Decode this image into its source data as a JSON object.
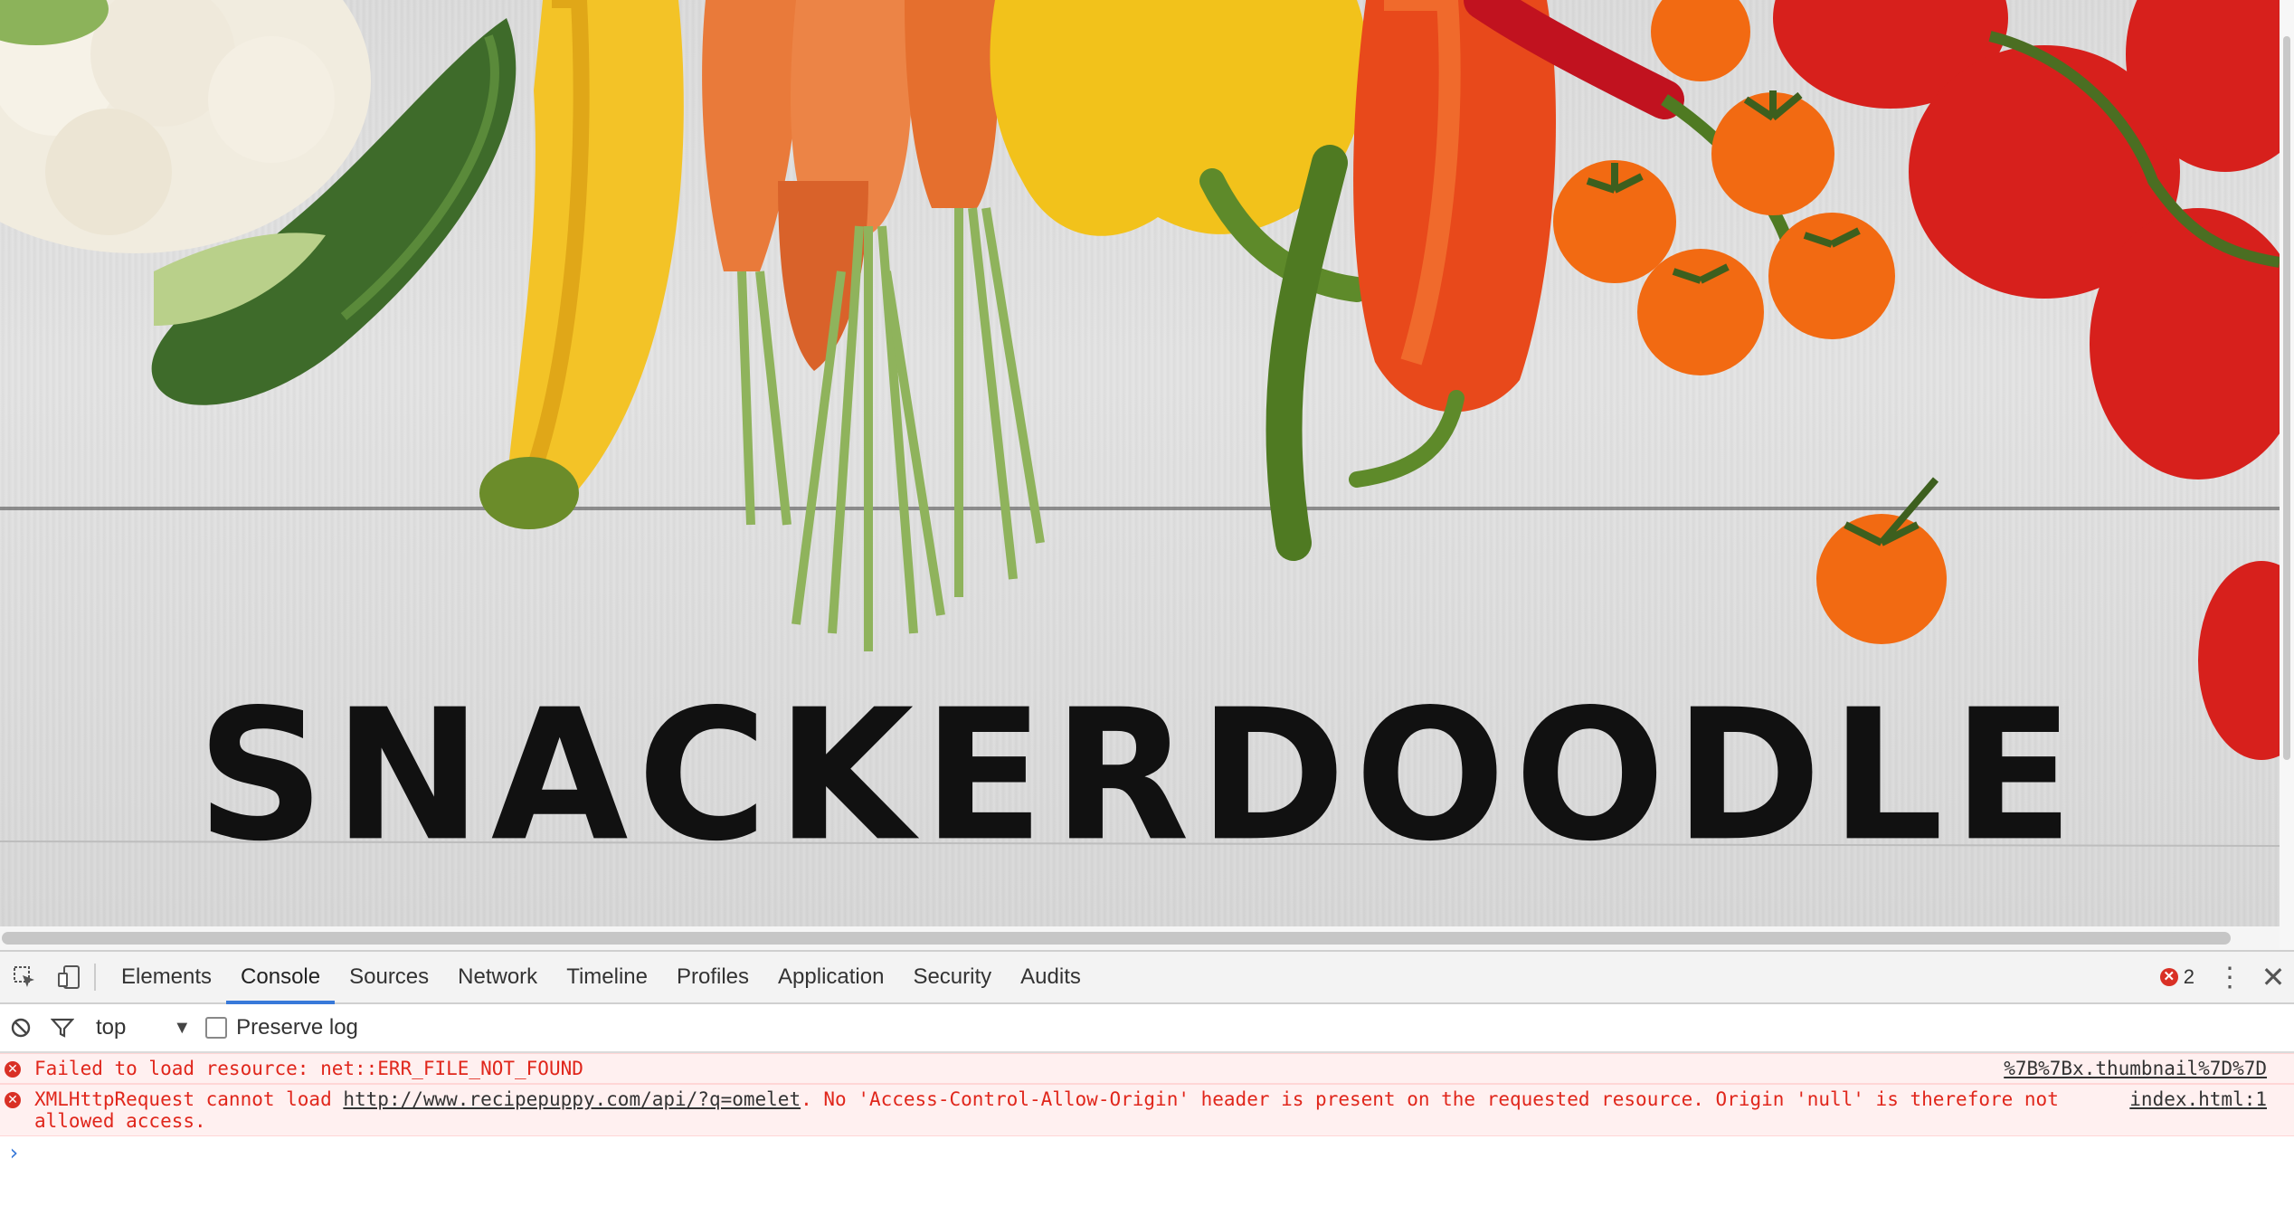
{
  "page": {
    "title_text": "SNACKERDOODLE"
  },
  "devtools": {
    "icons": {
      "inspect": "inspect-element-icon",
      "device": "device-toolbar-icon",
      "clear": "clear-console-icon",
      "filter": "filter-icon",
      "error": "error-icon",
      "more": "more-options-icon",
      "close": "close-icon"
    },
    "tabs": [
      {
        "label": "Elements",
        "active": false
      },
      {
        "label": "Console",
        "active": true
      },
      {
        "label": "Sources",
        "active": false
      },
      {
        "label": "Network",
        "active": false
      },
      {
        "label": "Timeline",
        "active": false
      },
      {
        "label": "Profiles",
        "active": false
      },
      {
        "label": "Application",
        "active": false
      },
      {
        "label": "Security",
        "active": false
      },
      {
        "label": "Audits",
        "active": false
      }
    ],
    "error_count": "2",
    "context_selector": "top",
    "preserve_log_label": "Preserve log",
    "preserve_log_checked": false,
    "messages": [
      {
        "level": "error",
        "text": "Failed to load resource: net::ERR_FILE_NOT_FOUND",
        "source": "%7B%7Bx.thumbnail%7D%7D"
      },
      {
        "level": "error",
        "prefix": "XMLHttpRequest cannot load ",
        "url": "http://www.recipepuppy.com/api/?q=omelet",
        "suffix": ". No 'Access-Control-Allow-Origin' header is present on the requested resource. Origin 'null' is therefore not allowed access.",
        "source": "index.html:1"
      }
    ],
    "prompt_symbol": "›"
  },
  "colors": {
    "accent": "#3879d9",
    "error": "#e0261b",
    "error_bg": "#fff0f0"
  }
}
